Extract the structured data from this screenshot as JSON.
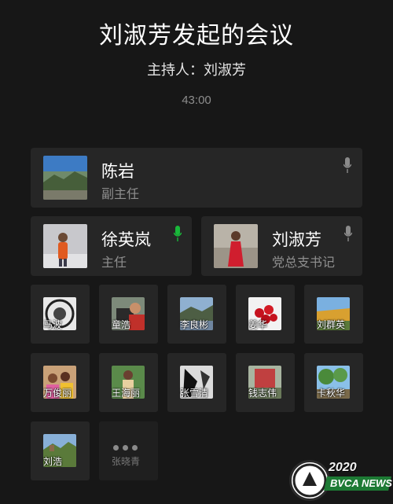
{
  "meeting": {
    "title": "刘淑芳发起的会议",
    "host": "主持人：刘淑芳",
    "elapsed": "43:00"
  },
  "colors": {
    "background": "#171717",
    "card": "#262626",
    "mic_active": "#19b83a",
    "mic_idle": "#8a8a8a"
  },
  "speakers": [
    {
      "name": "陈岩",
      "role": "副主任",
      "mic": "mic-icon",
      "mic_active": false
    },
    {
      "name": "徐英岚",
      "role": "主任",
      "mic": "mic-icon",
      "mic_active": true
    },
    {
      "name": "刘淑芳",
      "role": "党总支书记",
      "mic": "mic-icon",
      "mic_active": false
    }
  ],
  "participants": [
    {
      "name": "马波",
      "active": true
    },
    {
      "name": "童浩",
      "active": true
    },
    {
      "name": "李良彬",
      "active": true
    },
    {
      "name": "姜华",
      "active": true
    },
    {
      "name": "刘群英",
      "active": true
    },
    {
      "name": "万俊丽",
      "active": true
    },
    {
      "name": "王海丽",
      "active": true
    },
    {
      "name": "张雪清",
      "active": true
    },
    {
      "name": "钱志伟",
      "active": true
    },
    {
      "name": "卡秋华",
      "active": true
    },
    {
      "name": "刘浩",
      "active": true
    },
    {
      "name": "张晓青",
      "active": false
    }
  ],
  "watermark": {
    "year": "2020",
    "text": "BVCA NEWS"
  }
}
